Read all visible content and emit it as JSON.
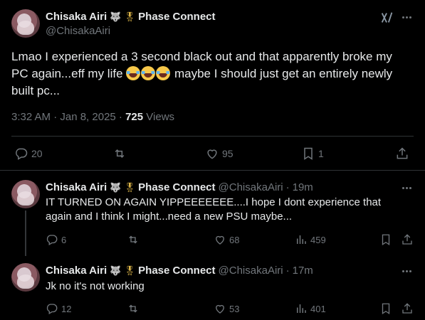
{
  "main": {
    "display_name": "Chisaka Airi",
    "affiliation": "Phase Connect",
    "handle": "@ChisakaAiri",
    "text_before": "Lmao I experienced a 3 second black out and that apparently broke my PC again...eff my life ",
    "text_after": " maybe I should just get an entirely newly built pc...",
    "laugh_emoji_icon": "face-with-tears-of-joy-icon",
    "timestamp": "3:32 AM · Jan 8, 2025 · ",
    "views_count": "725",
    "views_label": " Views",
    "replies": "20",
    "reposts": "",
    "likes": "95",
    "bookmarks": "1"
  },
  "replies": [
    {
      "display_name": "Chisaka Airi",
      "affiliation": "Phase Connect",
      "handle": "@ChisakaAiri",
      "time": "19m",
      "text": "IT TURNED ON AGAIN YIPPEEEEEEE....I hope I dont experience that again and I think I might...need a new PSU maybe...",
      "replies": "6",
      "reposts": "",
      "likes": "68",
      "views": "459"
    },
    {
      "display_name": "Chisaka Airi",
      "affiliation": "Phase Connect",
      "handle": "@ChisakaAiri",
      "time": "17m",
      "text": "Jk no it's not working",
      "replies": "12",
      "reposts": "",
      "likes": "53",
      "views": "401"
    }
  ],
  "colors": {
    "background": "#000000",
    "text": "#e7e9ea",
    "muted": "#71767b",
    "divider": "#2f3336"
  }
}
